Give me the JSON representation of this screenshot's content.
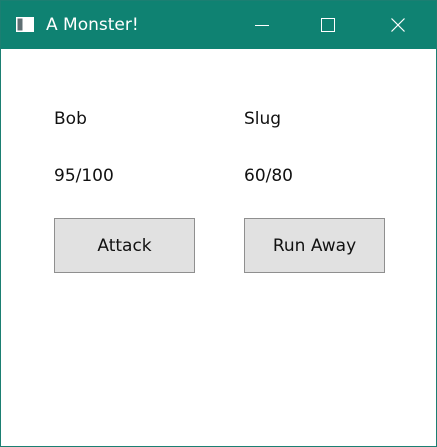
{
  "window": {
    "title": "A Monster!",
    "icon": "window-app-icon",
    "controls": [
      "minimize-icon",
      "maximize-icon",
      "close-icon"
    ],
    "accent_color": "#0f8272"
  },
  "combatants": {
    "player": {
      "name": "Bob",
      "hp": "95/100"
    },
    "monster": {
      "name": "Slug",
      "hp": "60/80"
    }
  },
  "actions": {
    "attack_label": "Attack",
    "run_away_label": "Run Away"
  }
}
